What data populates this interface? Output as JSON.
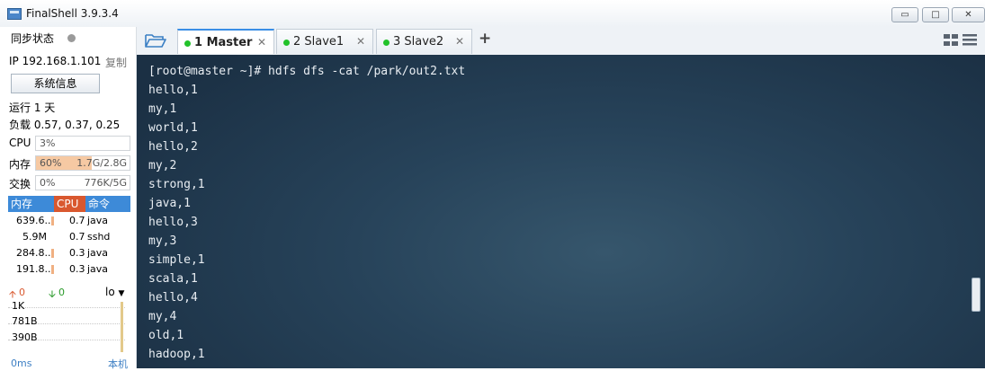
{
  "window": {
    "title": "FinalShell 3.9.3.4",
    "controls": {
      "minimize": "▭",
      "maximize": "□",
      "close": "✕"
    }
  },
  "sidebar": {
    "sync_label": "同步状态",
    "ip_label": "IP 192.168.1.101",
    "copy_label": "复制",
    "sysinfo_button": "系统信息",
    "uptime": "运行 1 天",
    "load": "负载 0.57, 0.37, 0.25",
    "metrics": [
      {
        "label": "CPU",
        "percent": "3%",
        "amount": "",
        "fill_fraction": 0.0
      },
      {
        "label": "内存",
        "percent": "60%",
        "amount": "1.7G/2.8G",
        "fill_fraction": 0.6
      },
      {
        "label": "交换",
        "percent": "0%",
        "amount": "776K/5G",
        "fill_fraction": 0.0
      }
    ],
    "process_table": {
      "headers": [
        "内存",
        "CPU",
        "命令"
      ],
      "header_colors": [
        "#3d8ad8",
        "#d9582f",
        "#3d8ad8"
      ],
      "rows": [
        {
          "mem": "639.6...",
          "cpu": "0.7",
          "cmd": "java"
        },
        {
          "mem": "5.9M",
          "cpu": "0.7",
          "cmd": "sshd"
        },
        {
          "mem": "284.8...",
          "cpu": "0.3",
          "cmd": "java"
        },
        {
          "mem": "191.8...",
          "cpu": "0.3",
          "cmd": "java"
        }
      ]
    },
    "network": {
      "upload": "0",
      "download": "0",
      "interface": "lo",
      "levels": [
        "1K",
        "781B",
        "390B"
      ],
      "latency": "0ms",
      "host": "本机"
    }
  },
  "toolbar": {
    "folder_icon": "folder-icon",
    "add_tab": "+"
  },
  "tabs": [
    {
      "label": "1 Master",
      "active": true,
      "status_color": "#22c22a"
    },
    {
      "label": "2 Slave1",
      "active": false,
      "status_color": "#22c22a"
    },
    {
      "label": "3 Slave2",
      "active": false,
      "status_color": "#22c22a"
    }
  ],
  "terminal": {
    "lines": [
      "[root@master ~]# hdfs dfs -cat /park/out2.txt",
      "hello,1",
      "my,1",
      "world,1",
      "hello,2",
      "my,2",
      "strong,1",
      "java,1",
      "hello,3",
      "my,3",
      "simple,1",
      "scala,1",
      "hello,4",
      "my,4",
      "old,1",
      "hadoop,1"
    ]
  }
}
